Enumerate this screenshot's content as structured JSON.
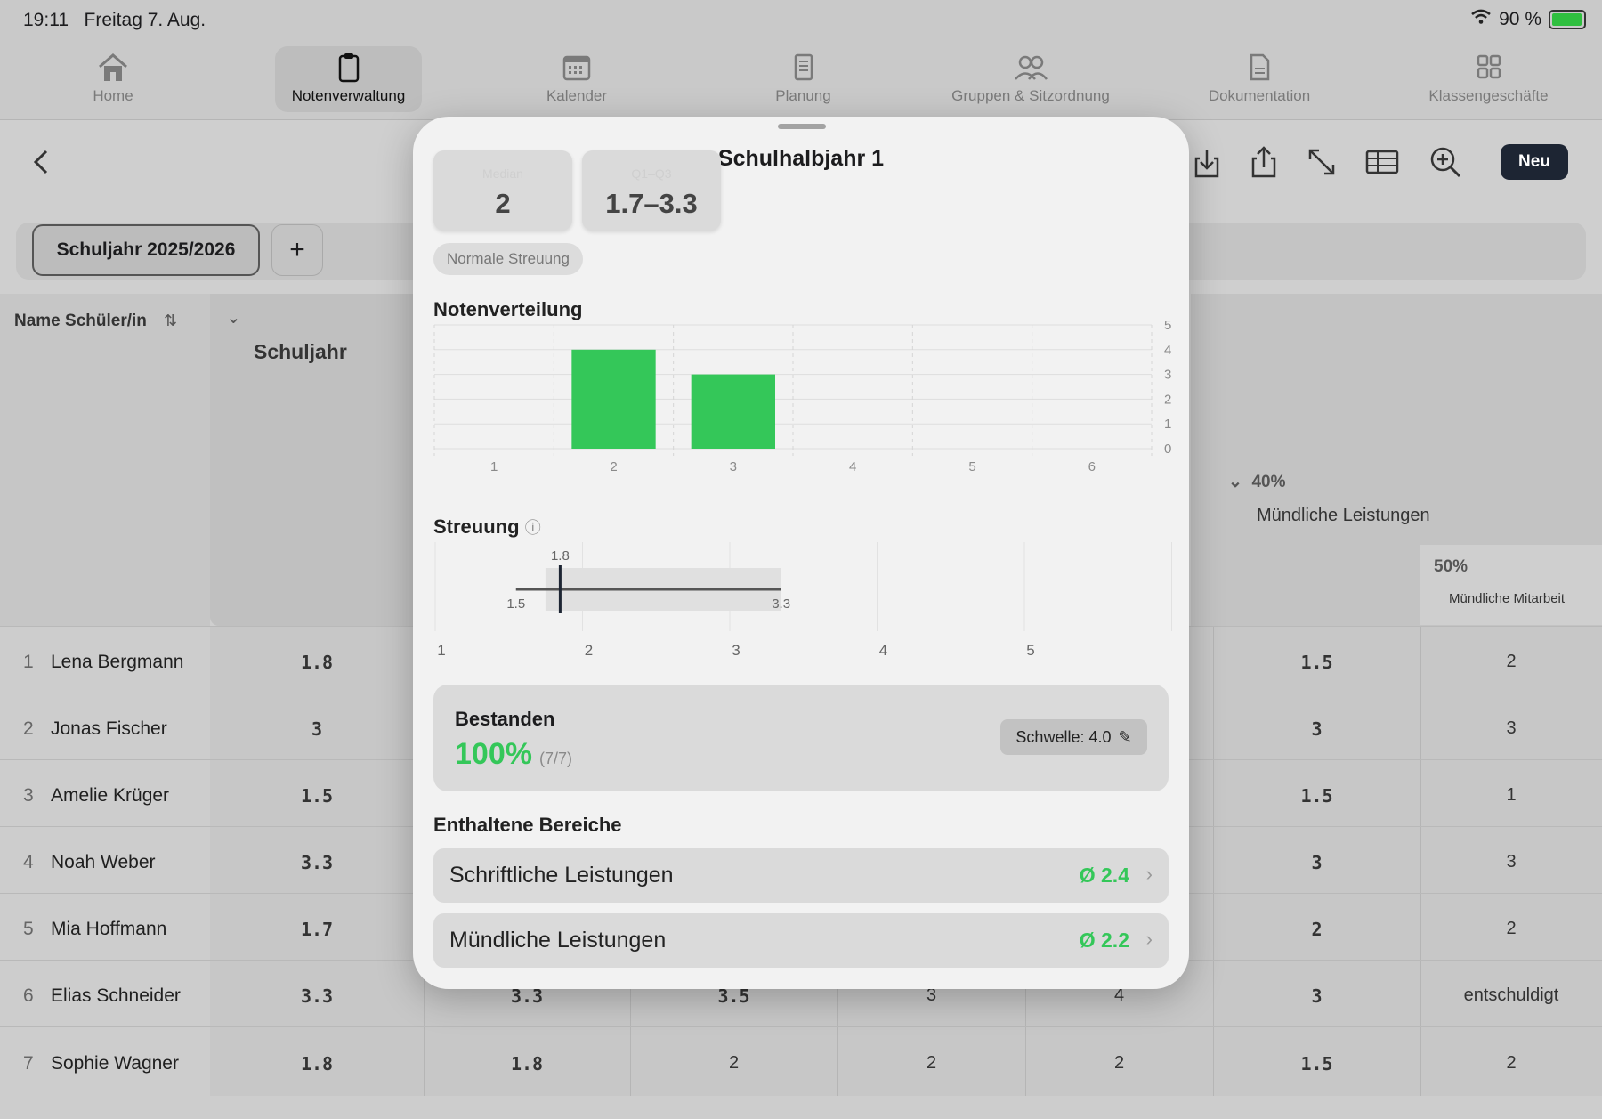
{
  "status": {
    "time": "19:11",
    "date": "Freitag 7. Aug.",
    "battery": "90 %"
  },
  "tabs": [
    {
      "label": "Home",
      "icon": "house-icon"
    },
    {
      "label": "Notenverwaltung",
      "icon": "clipboard-icon"
    },
    {
      "label": "Kalender",
      "icon": "calendar-icon"
    },
    {
      "label": "Planung",
      "icon": "document-list-icon"
    },
    {
      "label": "Gruppen & Sitzordnung",
      "icon": "people-icon"
    },
    {
      "label": "Dokumentation",
      "icon": "document-icon"
    },
    {
      "label": "Klassengeschäfte",
      "icon": "grid-icon"
    }
  ],
  "toolbar": {
    "new_label": "Neu"
  },
  "year_chip": "Schuljahr 2025/2026",
  "plus_label": "+",
  "table": {
    "name_header": "Name Schüler/in",
    "year_header": "Schuljahr",
    "muend_percent": "40%",
    "muend_label": "Mündliche Leistungen",
    "sub_percent": "50%",
    "sub_label": "Mündliche Mitarbeit",
    "rows": [
      {
        "num": "1",
        "name": "Lena Bergmann",
        "year": "1.8",
        "muend": "1.5",
        "mit": "2"
      },
      {
        "num": "2",
        "name": "Jonas Fischer",
        "year": "3",
        "muend": "3",
        "mit": "3"
      },
      {
        "num": "3",
        "name": "Amelie Krüger",
        "year": "1.5",
        "muend": "1.5",
        "mit": "1"
      },
      {
        "num": "4",
        "name": "Noah Weber",
        "year": "3.3",
        "muend": "3",
        "mit": "3"
      },
      {
        "num": "5",
        "name": "Mia Hoffmann",
        "year": "1.7",
        "muend": "2",
        "mit": "2"
      },
      {
        "num": "6",
        "name": "Elias Schneider",
        "year": "3.3",
        "c2": "3.3",
        "c3": "3.5",
        "c4": "3",
        "c5": "4",
        "muend": "3",
        "mit": "entschuldigt"
      },
      {
        "num": "7",
        "name": "Sophie Wagner",
        "year": "1.8",
        "c2": "1.8",
        "c3": "2",
        "c4": "2",
        "c5": "2",
        "muend": "1.5",
        "mit": "2"
      }
    ]
  },
  "sheet": {
    "title": "Schulhalbjahr 1",
    "stats": [
      {
        "label": "Median",
        "value": "2"
      },
      {
        "label": "Q1–Q3",
        "value": "1.7–3.3"
      }
    ],
    "spread_badge": "Normale Streuung",
    "dist_title": "Notenverteilung",
    "streuung_title": "Streuung",
    "bestanden": {
      "title": "Bestanden",
      "percent": "100%",
      "count": "(7/7)",
      "threshold": "Schwelle: 4.0"
    },
    "areas_title": "Enthaltene Bereiche",
    "areas": [
      {
        "name": "Schriftliche Leistungen",
        "avg": "Ø 2.4"
      },
      {
        "name": "Mündliche Leistungen",
        "avg": "Ø 2.2"
      }
    ]
  },
  "chart_data": [
    {
      "type": "bar",
      "title": "Notenverteilung",
      "categories": [
        "1",
        "2",
        "3",
        "4",
        "5",
        "6"
      ],
      "values": [
        0,
        4,
        3,
        0,
        0,
        0
      ],
      "ylim": [
        0,
        5
      ],
      "yticks": [
        "0",
        "1",
        "2",
        "3",
        "4",
        "5"
      ],
      "color": "#34c759"
    },
    {
      "type": "box",
      "title": "Streuung",
      "min": 1.5,
      "q1": 1.7,
      "median": 1.8,
      "q3": 3.3,
      "max": 3.3,
      "labels": {
        "median": "1.8",
        "min": "1.5",
        "max": "3.3"
      },
      "xlim": [
        1,
        6
      ],
      "xticks": [
        "1",
        "2",
        "3",
        "4",
        "5"
      ]
    }
  ],
  "colors": {
    "accent": "#34c759",
    "dark": "#1d2533"
  }
}
